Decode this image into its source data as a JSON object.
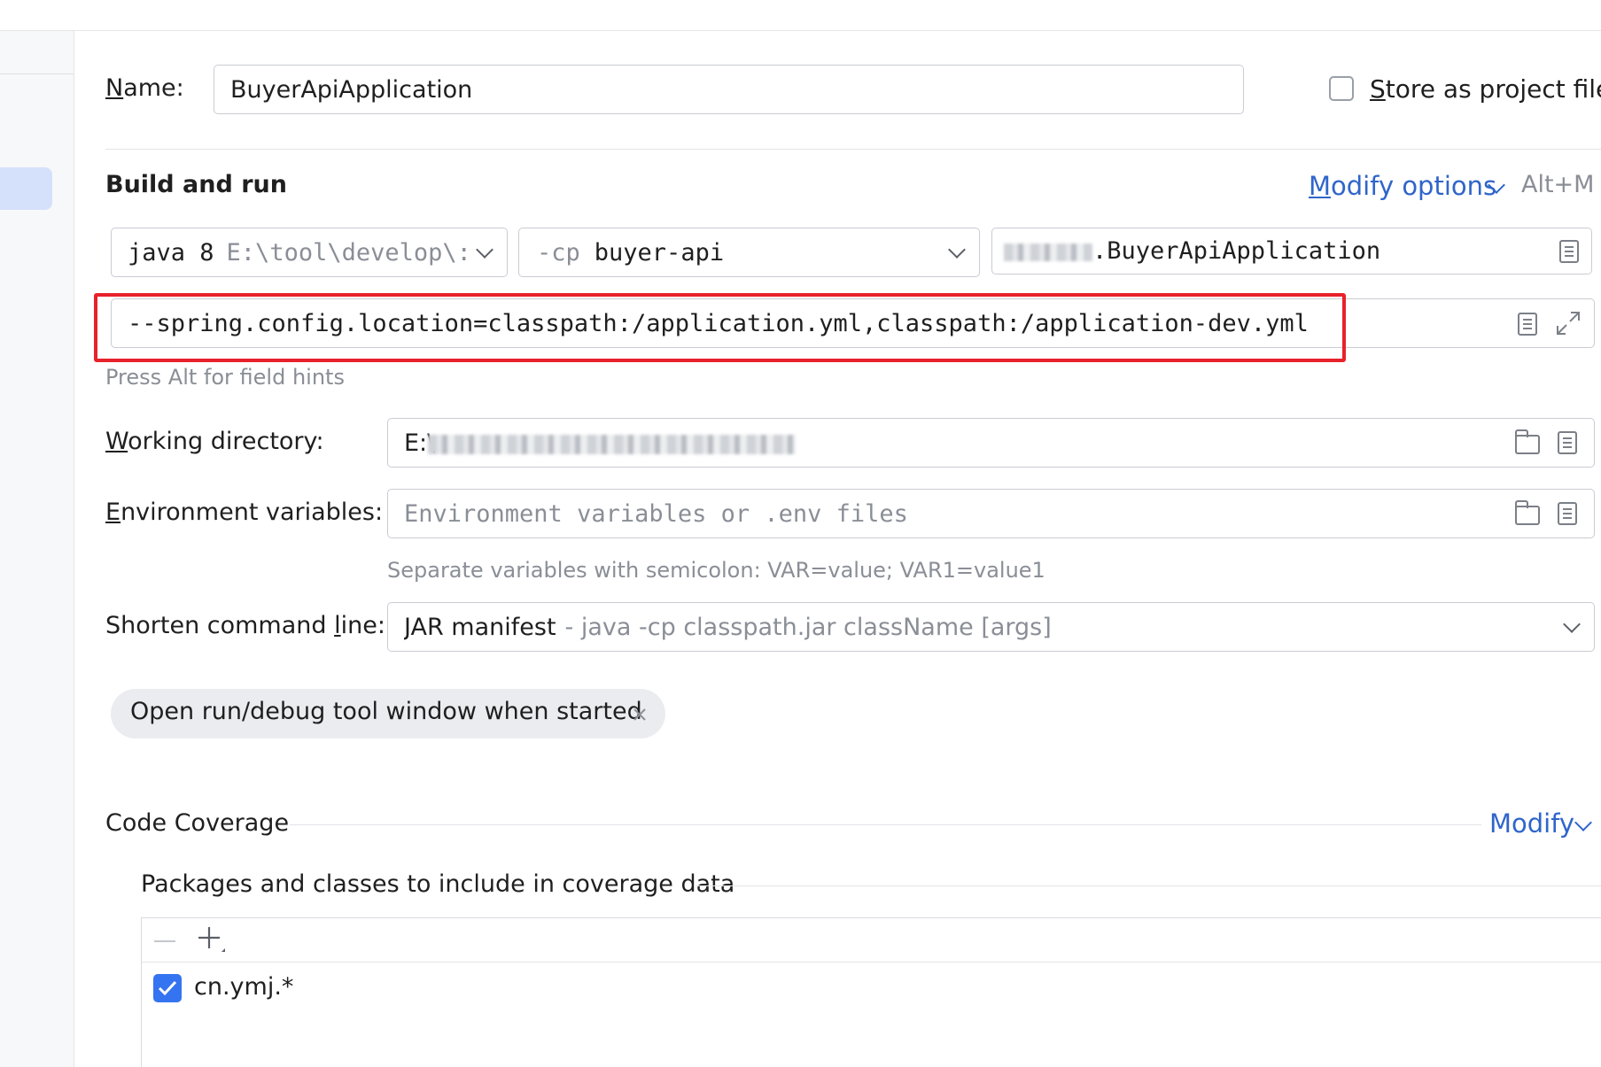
{
  "name": {
    "label": "Name:",
    "mnemonic": "N",
    "label_rest": "ame:",
    "value": "BuyerApiApplication"
  },
  "store_as_project_file": {
    "label": "Store as project file",
    "mnemonic": "S",
    "label_rest": "tore as project file",
    "checked": false
  },
  "build_and_run": {
    "title": "Build and run",
    "modify_options": {
      "mnemonic": "M",
      "label_rest": "odify options",
      "label": "Modify options",
      "shortcut": "Alt+M"
    },
    "jdk": {
      "java_label": "java 8",
      "path": "E:\\tool\\develop\\:"
    },
    "classpath": {
      "flag": "-cp",
      "module": "buyer-api"
    },
    "main_class": {
      "visible_suffix": ".BuyerApiApplication"
    },
    "program_args": "--spring.config.location=classpath:/application.yml,classpath:/application-dev.yml",
    "hint": "Press Alt for field hints"
  },
  "working_directory": {
    "label": "Working directory:",
    "mnemonic": "W",
    "label_rest": "orking directory:",
    "value_prefix": "E:\\"
  },
  "environment_variables": {
    "label": "Environment variables:",
    "mnemonic": "E",
    "label_rest": "nvironment variables:",
    "placeholder": "Environment variables or .env files",
    "hint": "Separate variables with semicolon: VAR=value; VAR1=value1"
  },
  "shorten_command_line": {
    "label_before": "Shorten command ",
    "mnemonic": "l",
    "label_after": "ine:",
    "value": "JAR manifest",
    "value_detail": "- java -cp classpath.jar className [args]"
  },
  "chip": {
    "label": "Open run/debug tool window when started"
  },
  "code_coverage": {
    "title": "Code Coverage",
    "modify": "Modify",
    "packages_title": "Packages and classes to include in coverage data",
    "entries": [
      {
        "pattern": "cn.ymj.*",
        "checked": true
      }
    ]
  },
  "colors": {
    "accent": "#2f65ca",
    "highlight_border": "#e8212b",
    "selection": "#d5e1fb"
  }
}
